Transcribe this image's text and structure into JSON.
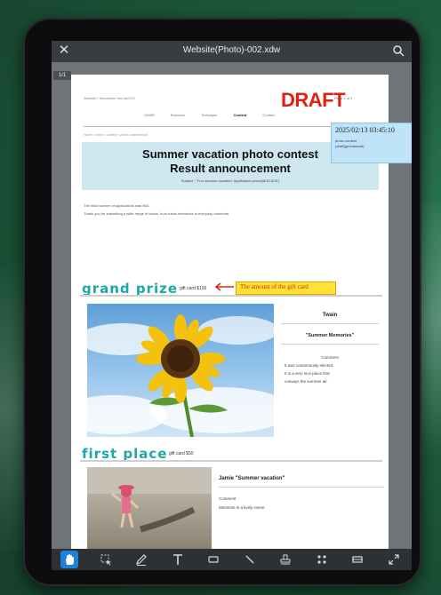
{
  "app": {
    "document_title": "Website(Photo)-002.xdw",
    "page_indicator": "1/1"
  },
  "document": {
    "site_name": "Website / Newsletter format2022",
    "draft_stamp": "DRAFT",
    "page_info": "Page 1 of 2",
    "nav": [
      "HOME",
      "Business",
      "Technique",
      "Contest",
      "Contact"
    ],
    "breadcrumb": "Home > event > contest > photo contest/result",
    "title_line1": "Summer vacation photo contest",
    "title_line2": "Result announcement",
    "subtitle": "Subject : \"Fun summer vacation\" Application period(8/10-8/31)",
    "intro_line1": "The total number of applications was 963.",
    "intro_line2": "Thank you for submitting a wide range of works, from travel memories to everyday moments.",
    "stamp": {
      "timestamp": "2025/02/13 03:45:10",
      "user": "photo contest",
      "note": "(draft)(provisional)"
    },
    "annotation": "The amount of the gift card",
    "grand_prize": {
      "label": "grand prize",
      "gift": "gift card $100",
      "name": "Twain",
      "work": "\"Summer Memories\"",
      "comment_label": "Comment",
      "comment_lines": [
        "It was unanimously elected.",
        "It is a very nice piece that",
        "conveys the summer air."
      ]
    },
    "first_place": {
      "label": "first place",
      "gift": "gift card $50",
      "name_work": "Jamie   \"Summer vacation\"",
      "comment_label": "Comment",
      "comment_line": "Moments in a lively scene"
    }
  },
  "toolbar": {
    "tools": [
      "hand-icon",
      "select-icon",
      "pen-icon",
      "text-icon",
      "rectangle-icon",
      "line-icon",
      "stamp-icon",
      "grid-icon",
      "frame-icon",
      "expand-icon"
    ]
  },
  "colors": {
    "accent": "#1e82d6",
    "draft": "#e02010",
    "section_heading": "#1aa8a8",
    "annotation_bg": "#ffe233"
  }
}
